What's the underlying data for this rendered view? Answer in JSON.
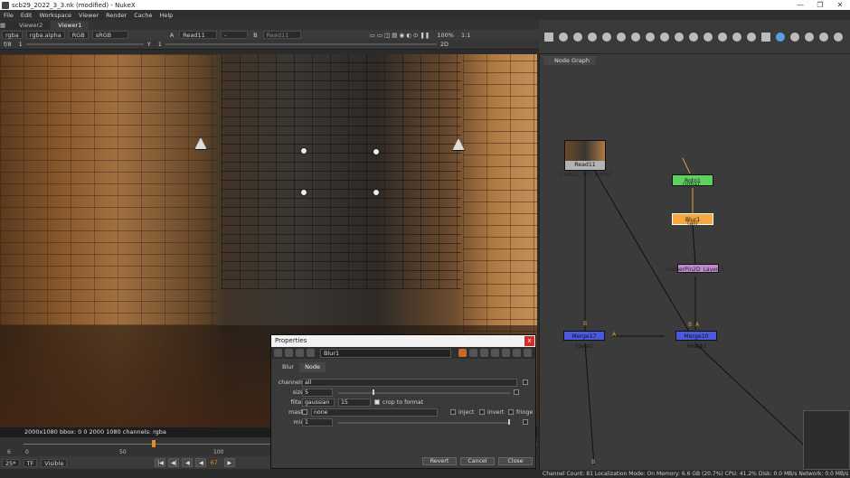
{
  "window": {
    "title": "scb29_2022_3_3.nk (modified) - NukeX",
    "controls": [
      "—",
      "❐",
      "✕"
    ]
  },
  "menu": [
    "File",
    "Edit",
    "Workspace",
    "Viewer",
    "Render",
    "Cache",
    "Help"
  ],
  "viewer": {
    "tabs": [
      "Viewer2",
      "Viewer1"
    ],
    "channels": "rgba",
    "alpha": "rgba.alpha",
    "display": "RGB",
    "colorspace": "sRGB",
    "input_a": "Read11",
    "input_op": "-",
    "input_b": "Read11",
    "zoom_label": "100%",
    "ratio": "1:1",
    "fstop": "f/8",
    "gain_value": "1",
    "y_label": "Y",
    "y_value": "1",
    "view_mode": "2D",
    "info_bar": "2000x1080  bbox: 0 0 2000 1080  channels: rgba"
  },
  "timeline": {
    "ticks": [
      "0",
      "50",
      "100"
    ],
    "start_frame": "6",
    "current_frame": "67"
  },
  "transport": {
    "fps": "25*",
    "tf": "TF",
    "visible": "Visible",
    "frame_field": "67"
  },
  "node_graph": {
    "tab_label": "Node Graph",
    "nodes": {
      "read": {
        "name": "Read11",
        "sub": "Cam01_001_00067"
      },
      "roto": {
        "name": "Roto1",
        "sub": "(rgba)"
      },
      "blur": {
        "name": "Blur1",
        "sub": "(all)"
      },
      "corner": {
        "name": "CornerPin2D_Layer_1"
      },
      "merge17": {
        "name": "Merge17 (over)"
      },
      "merge10": {
        "name": "Merge10 (mask)"
      }
    },
    "pipe_labels": {
      "b1": "B",
      "a1": "A",
      "b2": "B",
      "a2": "A",
      "b3": "B",
      "b4": "B"
    }
  },
  "status": "Channel Count: 81  Localization Mode: On  Memory: 6.6 GB (20.7%)  CPU: 41.2%  Disk: 0.0 MB/s  Network: 0.0 MB/s",
  "properties": {
    "title": "Properties",
    "close": "x",
    "node_name": "Blur1",
    "tabs": [
      "Blur",
      "Node"
    ],
    "channels_label": "channels",
    "channels_value": "all",
    "size_label": "size",
    "size_value": "5",
    "size_ticks": [
      "0",
      "10",
      "20",
      "30",
      "40",
      "50",
      "60",
      "70",
      "80",
      "90",
      "100"
    ],
    "filter_label": "filter",
    "filter_value": "gaussian",
    "filter_quality": "15",
    "crop_label": "crop to format",
    "mask_label": "mask",
    "mask_value": "none",
    "inject_label": "inject",
    "invert_label": "invert",
    "fringe_label": "fringe",
    "mix_label": "mix",
    "mix_value": "1",
    "mix_ticks": [
      "0",
      "0.1",
      "0.2",
      "0.3",
      "0.4",
      "0.5",
      "0.6",
      "0.7",
      "0.8",
      "0.9",
      "1"
    ],
    "buttons": {
      "revert": "Revert",
      "cancel": "Cancel",
      "close": "Close"
    }
  },
  "colors": {
    "roto_node": "#5fcf5f",
    "blur_node": "#f5a742",
    "corner_node": "#c08ad0",
    "merge_node": "#4a5adf",
    "read_node": "#b4b4b4"
  }
}
